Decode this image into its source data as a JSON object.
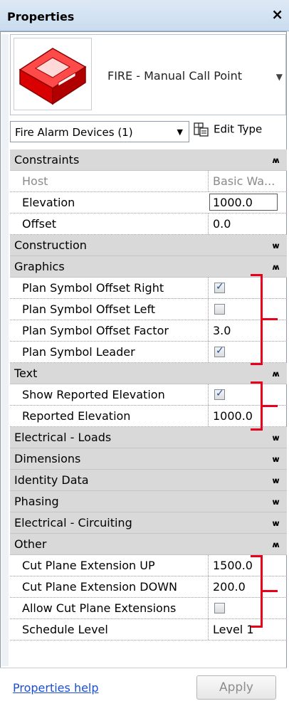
{
  "palette": {
    "title": "Properties",
    "close": "×"
  },
  "type_selector": {
    "name": "FIRE - Manual Call Point",
    "icon": "fire-call-point-icon"
  },
  "filter": {
    "label": "Fire Alarm Devices (1)",
    "edit_type": "Edit Type"
  },
  "groups": [
    {
      "label": "Constraints",
      "collapsed": false,
      "props": [
        {
          "label": "Host",
          "value": "Basic Wa...",
          "disabled": true
        },
        {
          "label": "Elevation",
          "value": "1000.0",
          "editing": true
        },
        {
          "label": "Offset",
          "value": "0.0"
        }
      ]
    },
    {
      "label": "Construction",
      "collapsed": true,
      "props": []
    },
    {
      "label": "Graphics",
      "collapsed": false,
      "props": [
        {
          "label": "Plan Symbol Offset Right",
          "checkbox": true,
          "checked": true
        },
        {
          "label": "Plan Symbol Offset Left",
          "checkbox": true,
          "checked": false
        },
        {
          "label": "Plan Symbol Offset Factor",
          "value": "3.0"
        },
        {
          "label": "Plan Symbol Leader",
          "checkbox": true,
          "checked": true
        }
      ]
    },
    {
      "label": "Text",
      "collapsed": false,
      "props": [
        {
          "label": "Show Reported Elevation",
          "checkbox": true,
          "checked": true
        },
        {
          "label": "Reported Elevation",
          "value": "1000.0"
        }
      ]
    },
    {
      "label": "Electrical - Loads",
      "collapsed": true,
      "props": []
    },
    {
      "label": "Dimensions",
      "collapsed": true,
      "props": []
    },
    {
      "label": "Identity Data",
      "collapsed": true,
      "props": []
    },
    {
      "label": "Phasing",
      "collapsed": true,
      "props": []
    },
    {
      "label": "Electrical - Circuiting",
      "collapsed": true,
      "props": []
    },
    {
      "label": "Other",
      "collapsed": false,
      "props": [
        {
          "label": "Cut Plane Extension UP",
          "value": "1500.0"
        },
        {
          "label": "Cut Plane Extension DOWN",
          "value": "200.0"
        },
        {
          "label": "Allow Cut Plane Extensions",
          "checkbox": true,
          "checked": false
        },
        {
          "label": "Schedule Level",
          "value": "Level 1"
        }
      ]
    }
  ],
  "chevrons": {
    "collapsed": "»",
    "expanded": "»"
  },
  "footer": {
    "help": "Properties help",
    "apply": "Apply"
  },
  "colors": {
    "annotation": "#e8001c",
    "group_bg": "#d9d9d9",
    "link": "#1a4ed8"
  }
}
